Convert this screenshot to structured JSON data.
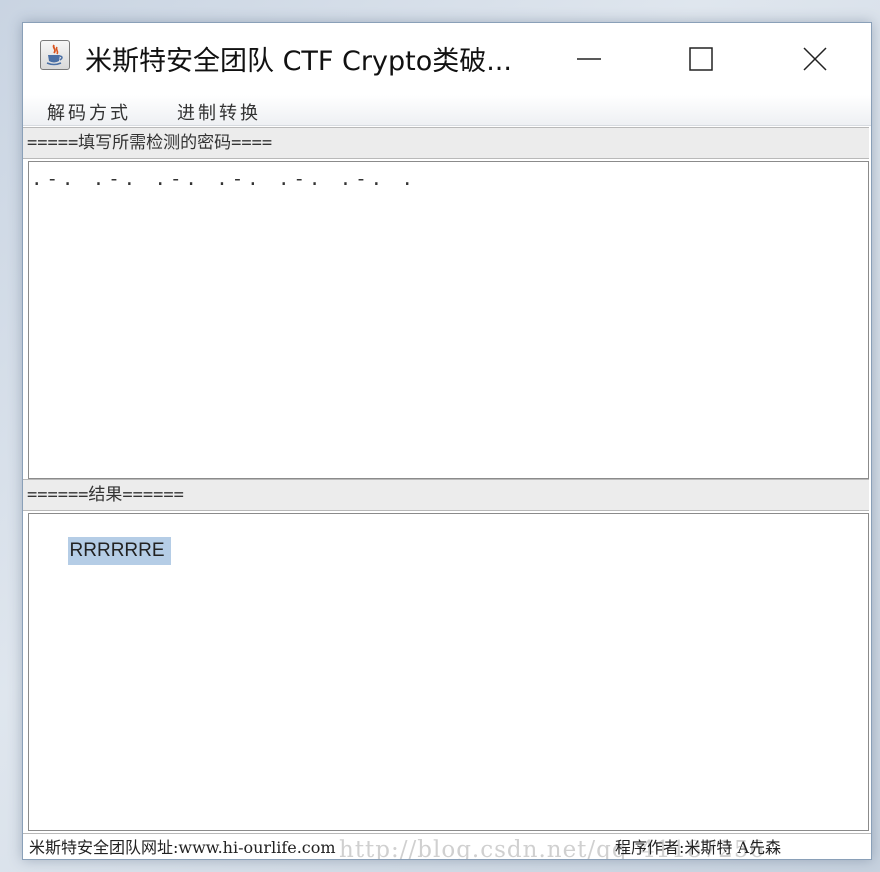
{
  "window": {
    "title": "米斯特安全团队 CTF Crypto类破..."
  },
  "menu": {
    "decode_label": "解码方式",
    "base_convert_label": "进制转换"
  },
  "input_section": {
    "label": "=====填写所需检测的密码====",
    "value": ".-. .-. .-. .-. .-. .-. ."
  },
  "output_section": {
    "label": "======结果======",
    "value": "RRRRRRE"
  },
  "status": {
    "site": "米斯特安全团队网址:www.hi-ourlife.com",
    "author": "程序作者:米斯特 A先森"
  },
  "watermark": {
    "text": "http://blog.csdn.net/qq_41187256"
  },
  "icons": {
    "app": "java-cup-icon",
    "minimize": "minimize-icon",
    "maximize": "maximize-icon",
    "close": "close-icon"
  },
  "colors": {
    "selection": "#b5cde6",
    "label_background": "#ececec"
  }
}
